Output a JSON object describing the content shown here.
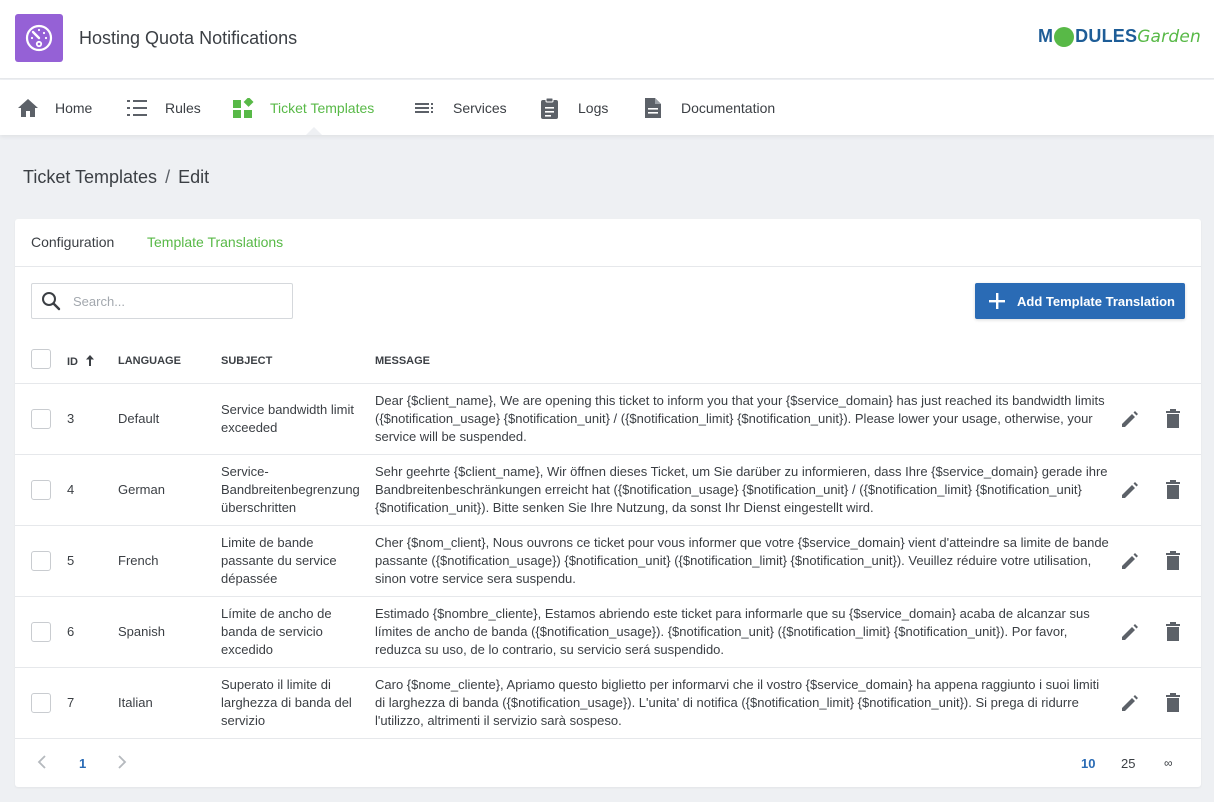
{
  "app": {
    "title": "Hosting Quota Notifications",
    "icon": "speedometer-icon"
  },
  "brand": {
    "part1": "M",
    "part2": "DULES",
    "part3": "Garden"
  },
  "nav": {
    "items": [
      {
        "label": "Home",
        "icon": "home-icon"
      },
      {
        "label": "Rules",
        "icon": "list-numbered-icon"
      },
      {
        "label": "Ticket Templates",
        "icon": "widgets-icon",
        "active": true
      },
      {
        "label": "Services",
        "icon": "list-icon"
      },
      {
        "label": "Logs",
        "icon": "clipboard-icon"
      },
      {
        "label": "Documentation",
        "icon": "document-icon"
      }
    ]
  },
  "breadcrumb": {
    "parent": "Ticket Templates",
    "separator": "/",
    "current": "Edit"
  },
  "tabs": {
    "configuration": "Configuration",
    "translations": "Template Translations"
  },
  "search": {
    "placeholder": "Search..."
  },
  "add_button": {
    "label": "Add Template Translation"
  },
  "table": {
    "columns": {
      "id": "ID",
      "language": "LANGUAGE",
      "subject": "SUBJECT",
      "message": "MESSAGE"
    },
    "sort": {
      "column": "ID",
      "direction": "ascending"
    },
    "rows": [
      {
        "id": "3",
        "language": "Default",
        "subject": "Service bandwidth limit exceeded",
        "message": "Dear {$client_name}, We are opening this ticket to inform you that your {$service_domain} has just reached its bandwidth limits ({$notification_usage} {$notification_unit} / ({$notification_limit} {$notification_unit}). Please lower your usage, otherwise, your service will be suspended."
      },
      {
        "id": "4",
        "language": "German",
        "subject": "Service-Bandbreitenbegrenzung überschritten",
        "message": "Sehr geehrte {$client_name}, Wir öffnen dieses Ticket, um Sie darüber zu informieren, dass Ihre {$service_domain} gerade ihre Bandbreitenbeschränkungen erreicht hat ({$notification_usage} {$notification_unit} / ({$notification_limit} {$notification_unit} {$notification_unit}). Bitte senken Sie Ihre Nutzung, da sonst Ihr Dienst eingestellt wird."
      },
      {
        "id": "5",
        "language": "French",
        "subject": "Limite de bande passante du service dépassée",
        "message": "Cher {$nom_client}, Nous ouvrons ce ticket pour vous informer que votre {$service_domain} vient d'atteindre sa limite de bande passante ({$notification_usage}) {$notification_unit} ({$notification_limit} {$notification_unit}). Veuillez réduire votre utilisation, sinon votre service sera suspendu."
      },
      {
        "id": "6",
        "language": "Spanish",
        "subject": "Límite de ancho de banda de servicio excedido",
        "message": "Estimado {$nombre_cliente}, Estamos abriendo este ticket para informarle que su {$service_domain} acaba de alcanzar sus límites de ancho de banda ({$notification_usage}). {$notification_unit} ({$notification_limit} {$notification_unit}). Por favor, reduzca su uso, de lo contrario, su servicio será suspendido."
      },
      {
        "id": "7",
        "language": "Italian",
        "subject": "Superato il limite di larghezza di banda del servizio",
        "message": "Caro {$nome_cliente}, Apriamo questo biglietto per informarvi che il vostro {$service_domain} ha appena raggiunto i suoi limiti di larghezza di banda ({$notification_usage}). L'unita' di notifica ({$notification_limit} {$notification_unit}). Si prega di ridurre l'utilizzo, altrimenti il servizio sarà sospeso."
      }
    ]
  },
  "pagination": {
    "current_page": "1",
    "page_sizes": [
      "10",
      "25",
      "∞"
    ],
    "active_size": "10"
  },
  "colors": {
    "accent_green": "#58b947",
    "primary_blue": "#2a6bb5",
    "icon_purple": "#9561d6"
  }
}
